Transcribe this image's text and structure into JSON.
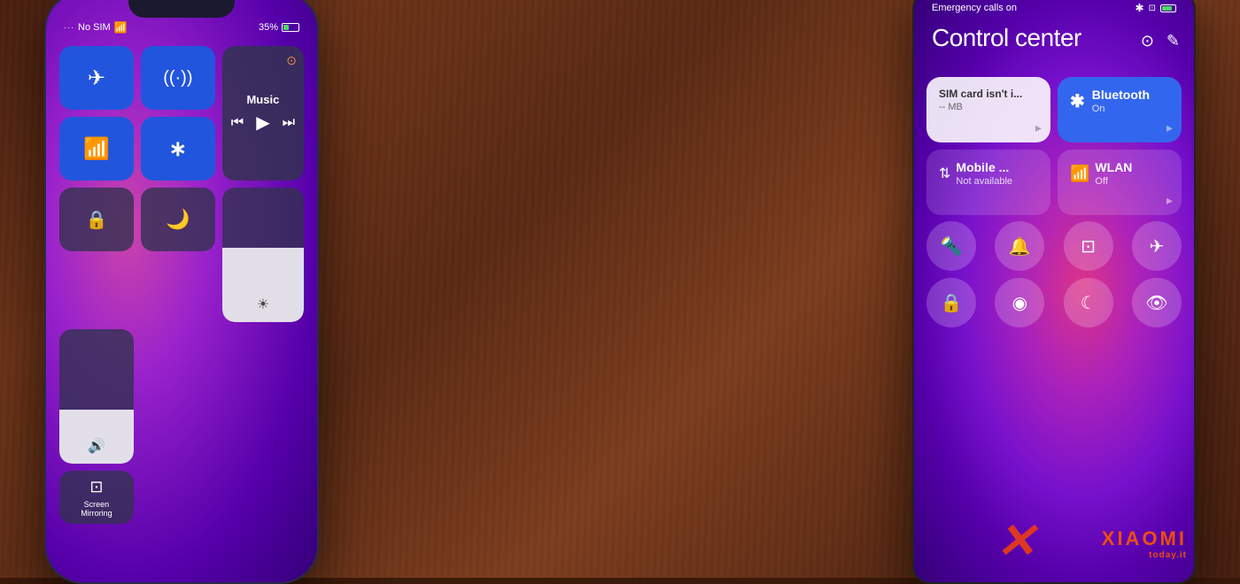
{
  "scene": {
    "background": "wooden table",
    "description": "Two smartphones side by side showing control center"
  },
  "phone_left": {
    "type": "iPhone",
    "status_bar": {
      "signal": "No SIM",
      "wifi": true,
      "battery": "35%"
    },
    "control_center": {
      "tiles": [
        {
          "id": "airplane",
          "label": "Airplane Mode",
          "icon": "✈",
          "active": true,
          "color": "blue"
        },
        {
          "id": "cellular",
          "label": "Cellular",
          "icon": "((·))",
          "active": true,
          "color": "blue"
        },
        {
          "id": "music",
          "label": "Music",
          "type": "music"
        },
        {
          "id": "wifi",
          "label": "WiFi",
          "icon": "wifi",
          "active": true,
          "color": "blue"
        },
        {
          "id": "bluetooth",
          "label": "Bluetooth",
          "icon": "bluetooth",
          "active": true,
          "color": "blue"
        },
        {
          "id": "rotation",
          "label": "Rotation Lock",
          "icon": "🔒",
          "active": false
        },
        {
          "id": "donotdisturb",
          "label": "Do Not Disturb",
          "icon": "🌙",
          "active": false
        },
        {
          "id": "brightness",
          "label": "Brightness",
          "type": "slider"
        },
        {
          "id": "volume",
          "label": "Volume",
          "type": "slider"
        },
        {
          "id": "screen_mirroring",
          "label": "Screen Mirroring",
          "icon": "⊡"
        }
      ],
      "music_title": "Music",
      "music_controls": [
        "⏮",
        "▶",
        "⏭"
      ]
    }
  },
  "phone_right": {
    "type": "Xiaomi Android",
    "status_bar": {
      "emergency": "Emergency calls on",
      "bluetooth_icon": true,
      "signal_icons": true,
      "battery_icon": true
    },
    "control_center": {
      "title": "Control center",
      "tiles": [
        {
          "id": "sim",
          "label": "SIM card isn't i...",
          "sublabel": "-- MB",
          "style": "white",
          "has_arrow": true
        },
        {
          "id": "bluetooth",
          "label": "Bluetooth",
          "sublabel": "On",
          "style": "blue",
          "icon": "bluetooth",
          "has_arrow": true
        },
        {
          "id": "mobile_data",
          "label": "Mobile ...",
          "sublabel": "Not available",
          "style": "dark",
          "icon": "mobile"
        },
        {
          "id": "wlan",
          "label": "WLAN",
          "sublabel": "Off",
          "style": "dark",
          "icon": "wifi"
        }
      ],
      "circle_row1": [
        {
          "id": "flashlight",
          "icon": "🔦",
          "label": "Flashlight"
        },
        {
          "id": "notification",
          "icon": "🔔",
          "label": "Notification"
        },
        {
          "id": "screenshot",
          "icon": "⊡",
          "label": "Screenshot"
        },
        {
          "id": "airplane",
          "icon": "✈",
          "label": "Airplane"
        }
      ],
      "circle_row2": [
        {
          "id": "lock",
          "icon": "🔒",
          "label": "Lock"
        },
        {
          "id": "location",
          "icon": "◉",
          "label": "Location"
        },
        {
          "id": "dnd",
          "icon": "☾",
          "label": "Do Not Disturb"
        },
        {
          "id": "eye",
          "icon": "👁",
          "label": "Eye"
        }
      ]
    }
  },
  "watermark": {
    "brand": "XIAOMI",
    "site": "today.it",
    "color": "#ff6600"
  }
}
